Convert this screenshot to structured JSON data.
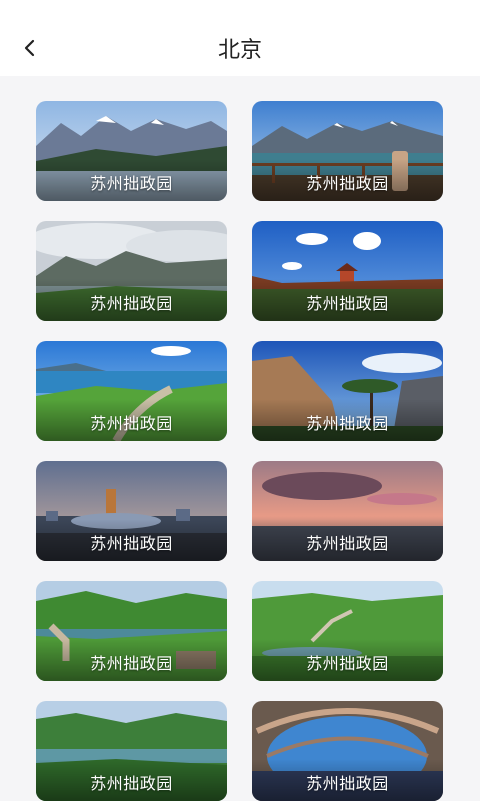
{
  "header": {
    "title": "北京",
    "back_icon": "chevron-left-icon"
  },
  "cards": [
    {
      "label": "苏州拙政园",
      "scene": "snowy mountains over lake"
    },
    {
      "label": "苏州拙政园",
      "scene": "mountain lake with railing"
    },
    {
      "label": "苏州拙政园",
      "scene": "misty lake valley"
    },
    {
      "label": "苏州拙政园",
      "scene": "pagoda under blue sky"
    },
    {
      "label": "苏州拙政园",
      "scene": "grassland path by sea"
    },
    {
      "label": "苏州拙政园",
      "scene": "rock cliff with pine"
    },
    {
      "label": "苏州拙政园",
      "scene": "city skyline at dusk"
    },
    {
      "label": "苏州拙政园",
      "scene": "sunset over sea"
    },
    {
      "label": "苏州拙政园",
      "scene": "great wall green hills"
    },
    {
      "label": "苏州拙政园",
      "scene": "great wall on ridge"
    },
    {
      "label": "苏州拙政园",
      "scene": "green lake and forest"
    },
    {
      "label": "苏州拙政园",
      "scene": "stadium interior"
    }
  ]
}
